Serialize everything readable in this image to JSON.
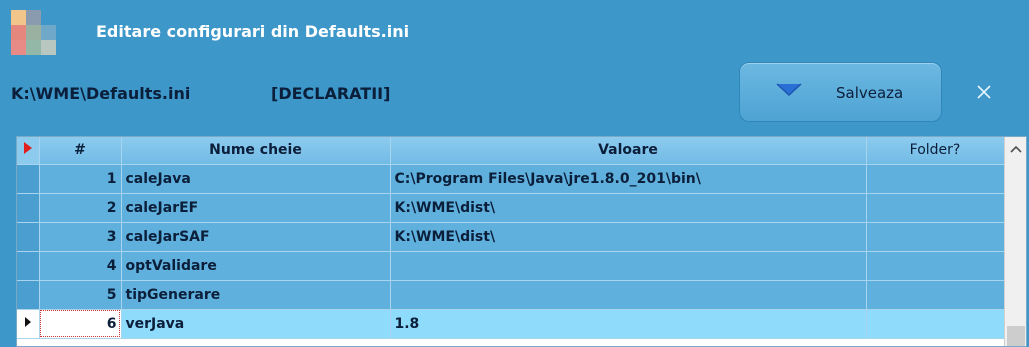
{
  "window": {
    "title": "Editare configurari din Defaults.ini"
  },
  "toolbar": {
    "file_path": "K:\\WME\\Defaults.ini",
    "section": "[DECLARATII]",
    "save_label": "Salveaza",
    "save_icon": "chevron-down-icon",
    "close_icon": "close-icon"
  },
  "grid": {
    "columns": {
      "num": "#",
      "key": "Nume cheie",
      "value": "Valoare",
      "folder": "Folder?"
    },
    "rows": [
      {
        "num": "1",
        "key": "caleJava",
        "value": "C:\\Program Files\\Java\\jre1.8.0_201\\bin\\",
        "folder": ""
      },
      {
        "num": "2",
        "key": "caleJarEF",
        "value": "K:\\WME\\dist\\",
        "folder": ""
      },
      {
        "num": "3",
        "key": "caleJarSAF",
        "value": "K:\\WME\\dist\\",
        "folder": ""
      },
      {
        "num": "4",
        "key": "optValidare",
        "value": "",
        "folder": ""
      },
      {
        "num": "5",
        "key": "tipGenerare",
        "value": "",
        "folder": ""
      },
      {
        "num": "6",
        "key": "verJava",
        "value": "1.8",
        "folder": ""
      }
    ],
    "current_row": 6
  },
  "colors": {
    "background": "#3d97c9",
    "row": "#5fb0dc",
    "current_row": "#8fdbfb",
    "header": "#8ccbee",
    "text": "#0b1e3a",
    "record_marker": "#e02020"
  }
}
